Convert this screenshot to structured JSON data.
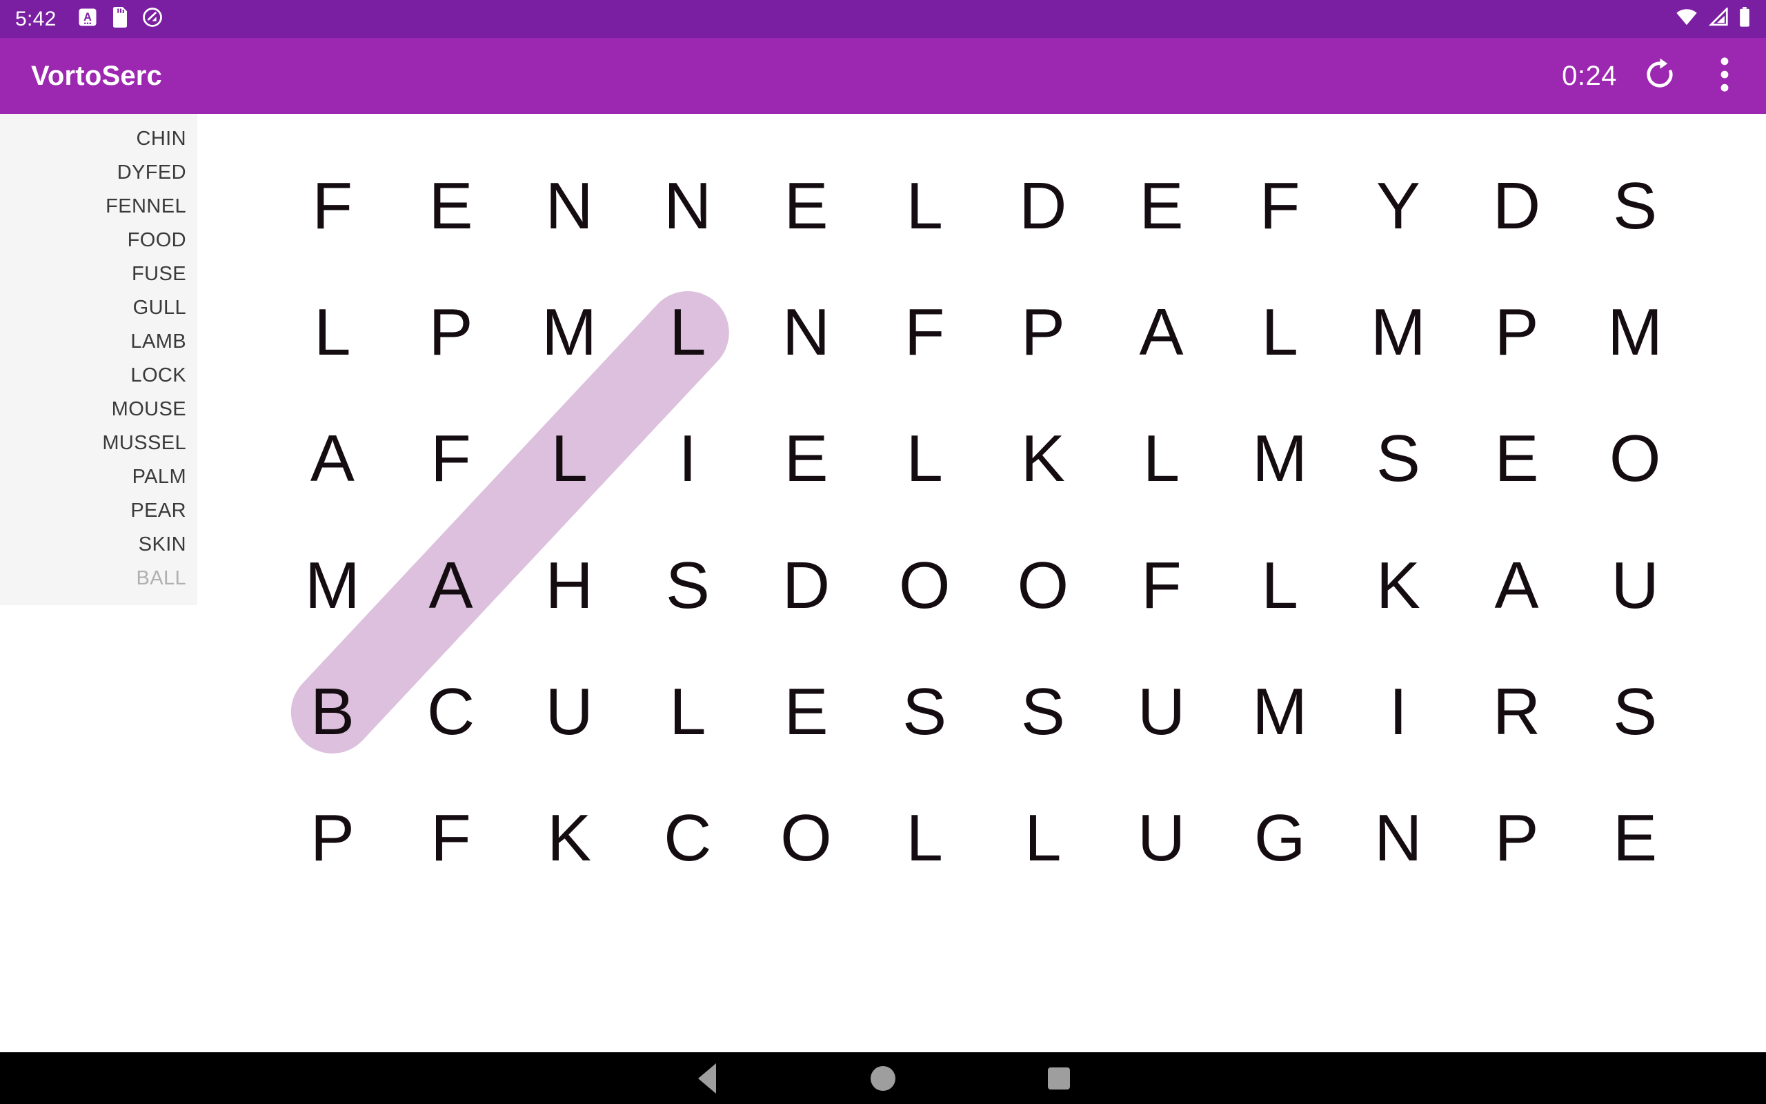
{
  "status_bar": {
    "clock": "5:42",
    "left_icons": [
      "a-badge-icon",
      "sd-card-icon",
      "android-q-icon"
    ],
    "right_icons": [
      "wifi-icon",
      "cell-signal-icon",
      "battery-icon"
    ],
    "background_color": "#7b1fa2"
  },
  "app_bar": {
    "title": "VortoSerc",
    "timer": "0:24",
    "refresh_icon": "refresh-icon",
    "overflow_icon": "more-vertical-icon",
    "background_color": "#9c27b0"
  },
  "word_list": {
    "panel_color": "#f5f5f5",
    "items": [
      {
        "word": "CHIN",
        "found": false
      },
      {
        "word": "DYFED",
        "found": false
      },
      {
        "word": "FENNEL",
        "found": false
      },
      {
        "word": "FOOD",
        "found": false
      },
      {
        "word": "FUSE",
        "found": false
      },
      {
        "word": "GULL",
        "found": false
      },
      {
        "word": "LAMB",
        "found": false
      },
      {
        "word": "LOCK",
        "found": false
      },
      {
        "word": "MOUSE",
        "found": false
      },
      {
        "word": "MUSSEL",
        "found": false
      },
      {
        "word": "PALM",
        "found": false
      },
      {
        "word": "PEAR",
        "found": false
      },
      {
        "word": "SKIN",
        "found": false
      },
      {
        "word": "BALL",
        "found": true
      }
    ]
  },
  "grid": {
    "columns": 12,
    "rows": 6,
    "letters": [
      [
        "F",
        "E",
        "N",
        "N",
        "E",
        "L",
        "D",
        "E",
        "F",
        "Y",
        "D",
        "S"
      ],
      [
        "L",
        "P",
        "M",
        "L",
        "N",
        "F",
        "P",
        "A",
        "L",
        "M",
        "P",
        "M"
      ],
      [
        "A",
        "F",
        "L",
        "I",
        "E",
        "L",
        "K",
        "L",
        "M",
        "S",
        "E",
        "O"
      ],
      [
        "M",
        "A",
        "H",
        "S",
        "D",
        "O",
        "O",
        "F",
        "L",
        "K",
        "A",
        "U"
      ],
      [
        "B",
        "C",
        "U",
        "L",
        "E",
        "S",
        "S",
        "U",
        "M",
        "I",
        "R",
        "S"
      ],
      [
        "P",
        "F",
        "K",
        "C",
        "O",
        "L",
        "L",
        "U",
        "G",
        "N",
        "P",
        "E"
      ]
    ]
  },
  "selection": {
    "word": "BALL",
    "highlight_color": "#dcc0dd",
    "start_cell": {
      "row": 1,
      "col": 3,
      "letter": "L"
    },
    "end_cell": {
      "row": 4,
      "col": 0,
      "letter": "B"
    },
    "direction": "diagonal-down-left"
  },
  "nav_bar": {
    "background_color": "#000000",
    "buttons": [
      "back-icon",
      "home-icon",
      "recents-icon"
    ]
  }
}
